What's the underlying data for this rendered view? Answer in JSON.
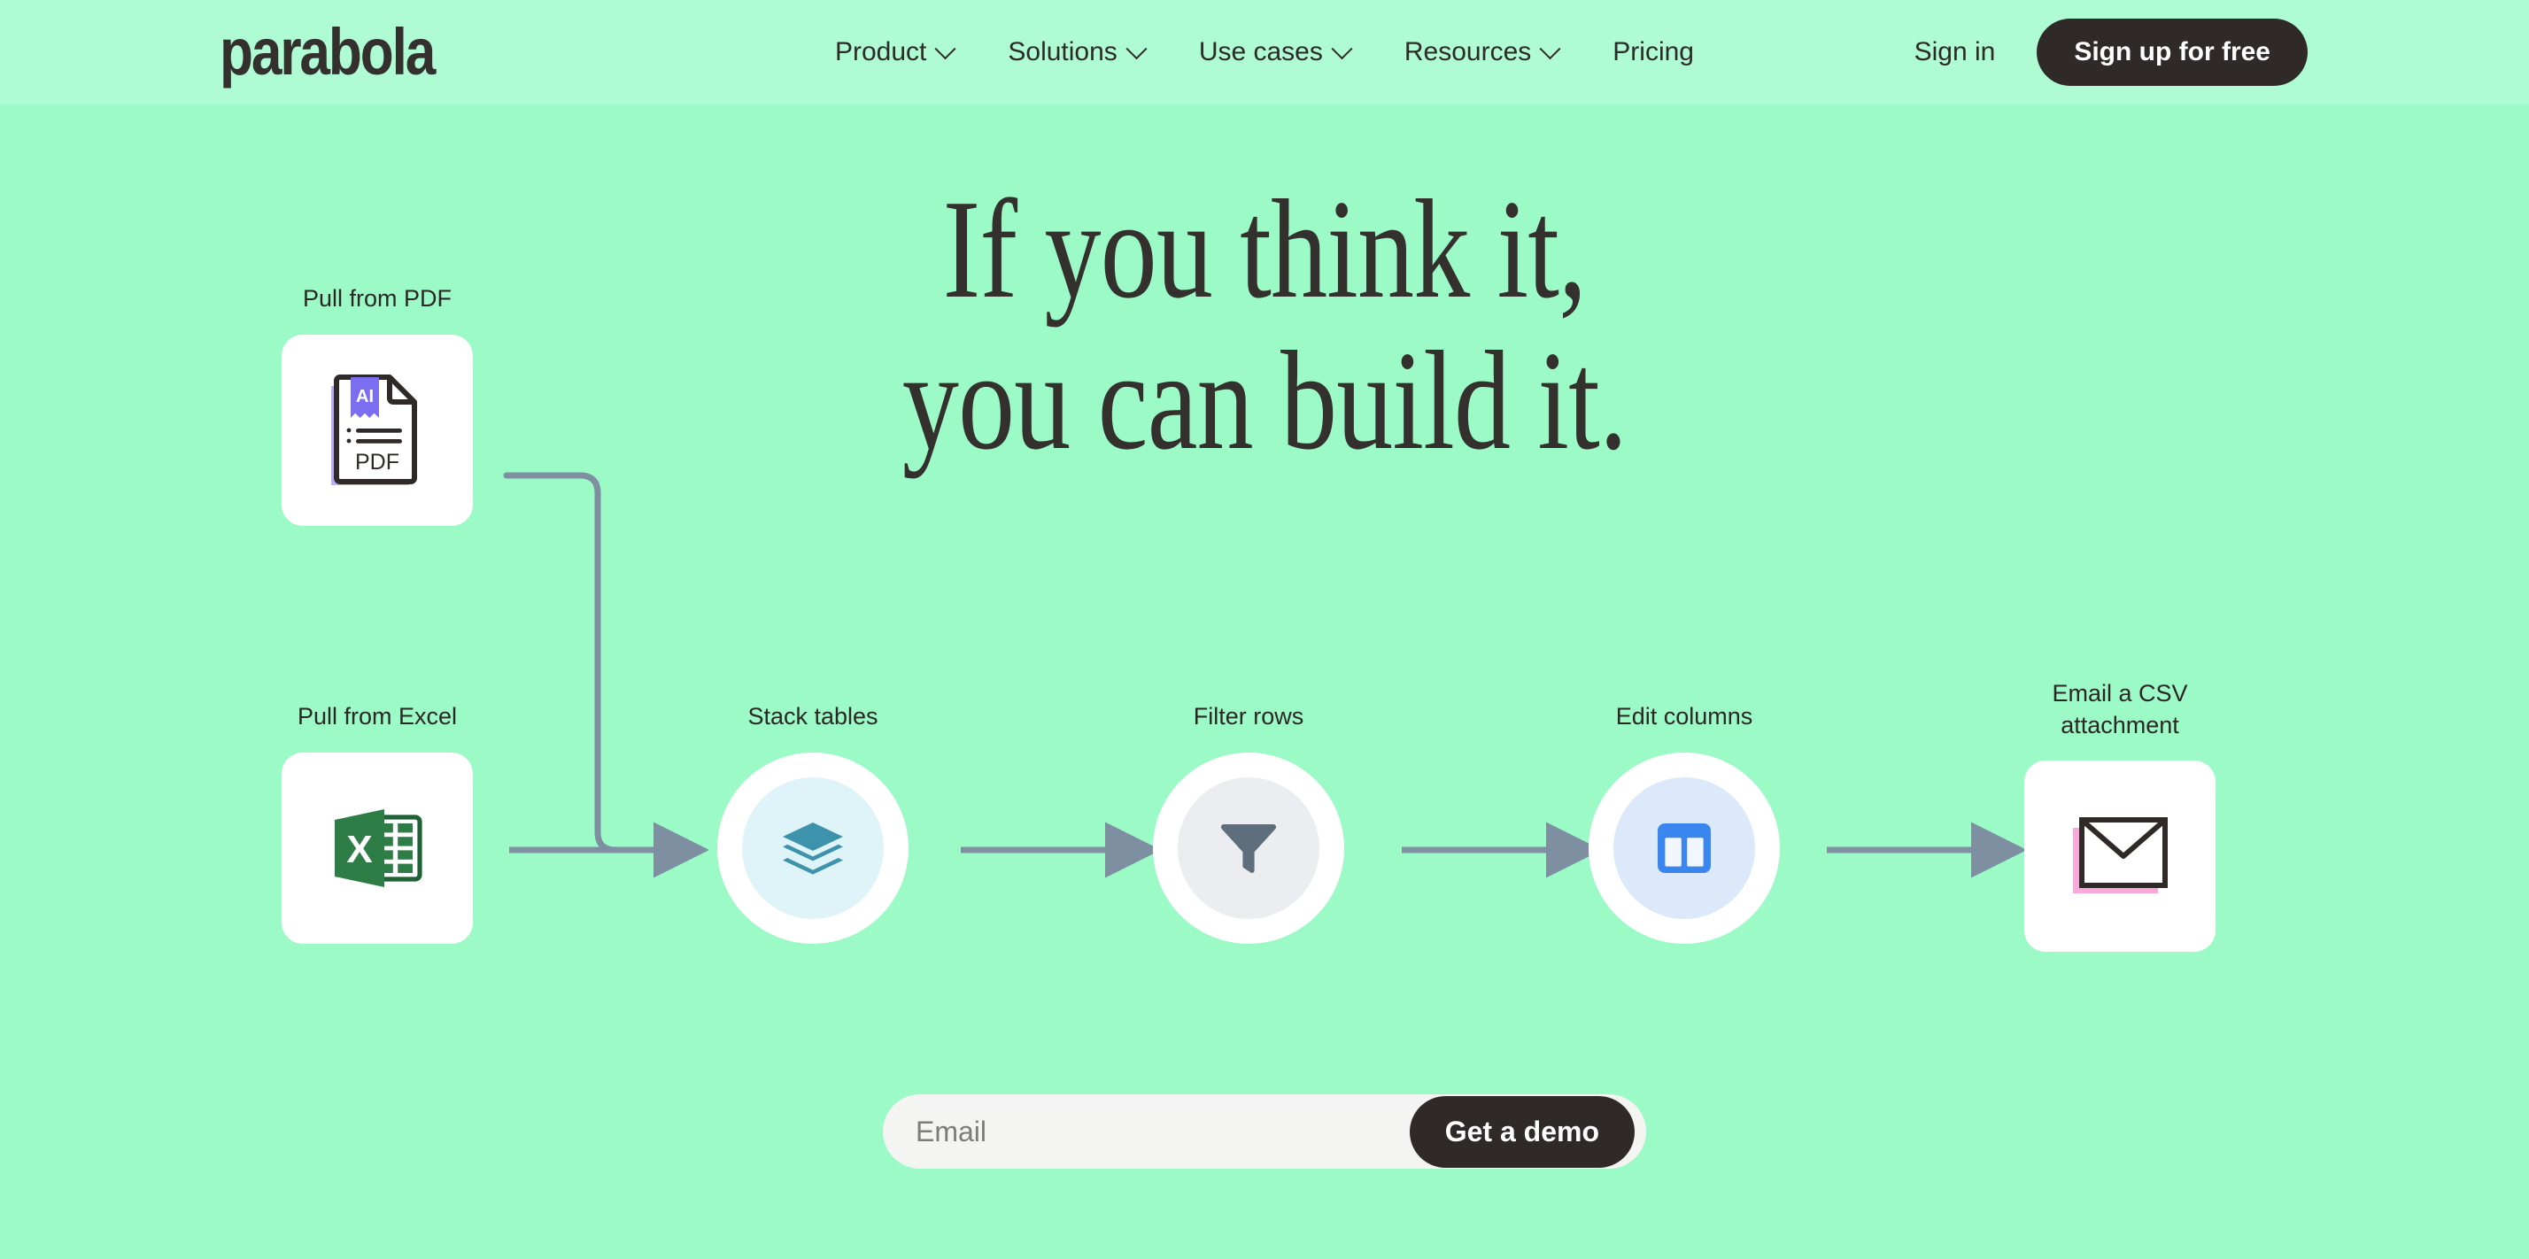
{
  "brand": {
    "logo_text": "parabola",
    "background_color": "#9cfac7",
    "header_background_color": "#aefbd4",
    "dark_color": "#2f2927",
    "connector_color": "#7e8fa2"
  },
  "header": {
    "nav_items": [
      {
        "label": "Product",
        "has_dropdown": true
      },
      {
        "label": "Solutions",
        "has_dropdown": true
      },
      {
        "label": "Use cases",
        "has_dropdown": true
      },
      {
        "label": "Resources",
        "has_dropdown": true
      },
      {
        "label": "Pricing",
        "has_dropdown": false
      }
    ],
    "sign_in_label": "Sign in",
    "sign_up_label": "Sign up for free"
  },
  "hero": {
    "headline_line1": "If you think it,",
    "headline_line2": "you can build it."
  },
  "flow": {
    "nodes": [
      {
        "id": "pdf",
        "label": "Pull from PDF",
        "icon": "pdf-file-icon",
        "shape": "card"
      },
      {
        "id": "excel",
        "label": "Pull from Excel",
        "icon": "excel-file-icon",
        "shape": "card"
      },
      {
        "id": "stack",
        "label": "Stack tables",
        "icon": "stack-layers-icon",
        "shape": "circle",
        "inner_color": "#dff4f8",
        "icon_color": "#3e93ac"
      },
      {
        "id": "filter",
        "label": "Filter rows",
        "icon": "funnel-icon",
        "shape": "circle",
        "inner_color": "#ecedf1",
        "icon_color": "#5e6e7d"
      },
      {
        "id": "columns",
        "label": "Edit columns",
        "icon": "columns-icon",
        "shape": "circle",
        "inner_color": "#dce9fb",
        "icon_color": "#3b86ee"
      },
      {
        "id": "email",
        "label": "Email a CSV\nattachment",
        "icon": "envelope-icon",
        "shape": "card"
      }
    ],
    "pdf_icon_badge_text": "AI",
    "pdf_icon_filetype_text": "PDF",
    "excel_icon_letter": "X"
  },
  "form": {
    "email_placeholder": "Email",
    "email_value": "",
    "submit_label": "Get a demo"
  }
}
